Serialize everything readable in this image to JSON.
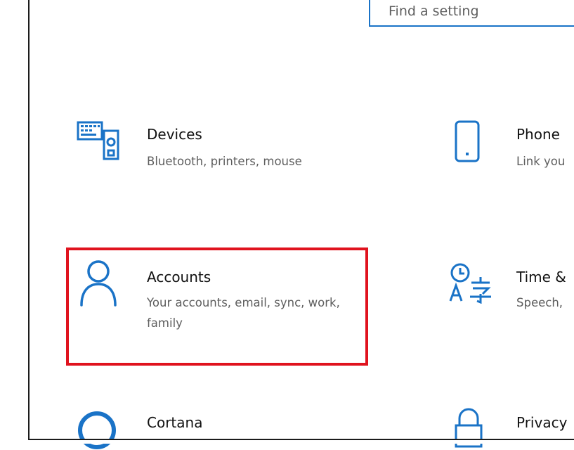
{
  "search": {
    "placeholder": "Find a setting"
  },
  "tiles": [
    {
      "title": "Devices",
      "desc": "Bluetooth, printers, mouse",
      "icon": "devices-icon"
    },
    {
      "title": "Phone",
      "desc": "Link you",
      "icon": "phone-icon"
    },
    {
      "title": "Accounts",
      "desc": "Your accounts, email, sync, work, family",
      "icon": "person-icon"
    },
    {
      "title": "Time &",
      "desc": "Speech,",
      "icon": "time-language-icon"
    },
    {
      "title": "Cortana",
      "desc": "",
      "icon": "cortana-icon"
    },
    {
      "title": "Privacy",
      "desc": "",
      "icon": "lock-icon"
    }
  ],
  "colors": {
    "accent": "#1a73c7",
    "highlight": "#e0131e",
    "secondary_text": "#5e5e5e"
  }
}
